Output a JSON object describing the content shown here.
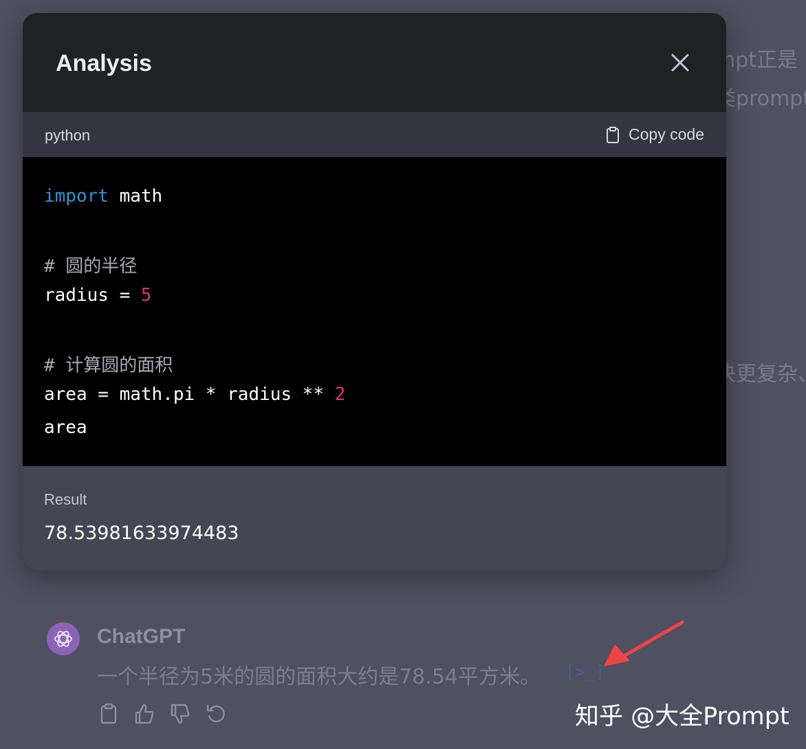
{
  "background": {
    "peek_lines": [
      "mpt正是",
      "类prompt",
      "决更复杂、"
    ]
  },
  "modal": {
    "title": "Analysis",
    "code_language": "python",
    "copy_label": "Copy code",
    "code_lines": [
      {
        "kw": "import",
        "rest": " math"
      },
      {
        "text": ""
      },
      {
        "comment": "# 圆的半径"
      },
      {
        "pre": "radius = ",
        "num": "5"
      },
      {
        "text": ""
      },
      {
        "comment": "# 计算圆的面积"
      },
      {
        "pre": "area = math.pi * radius ** ",
        "num": "2"
      },
      {
        "text": "area"
      }
    ],
    "result_label": "Result",
    "result_value": "78.53981633974483"
  },
  "message": {
    "sender": "ChatGPT",
    "text": "一个半径为5米的圆的面积大约是78.54平方米。",
    "code_indicator": "[>_]"
  },
  "watermark": "知乎 @大全Prompt",
  "colors": {
    "backdrop": "#4f5060",
    "modal_bg": "#202123",
    "code_bg": "#000000",
    "keyword": "#2e95d3",
    "number": "#df3079",
    "arrow": "#ef4444",
    "avatar": "#8b64b8"
  }
}
